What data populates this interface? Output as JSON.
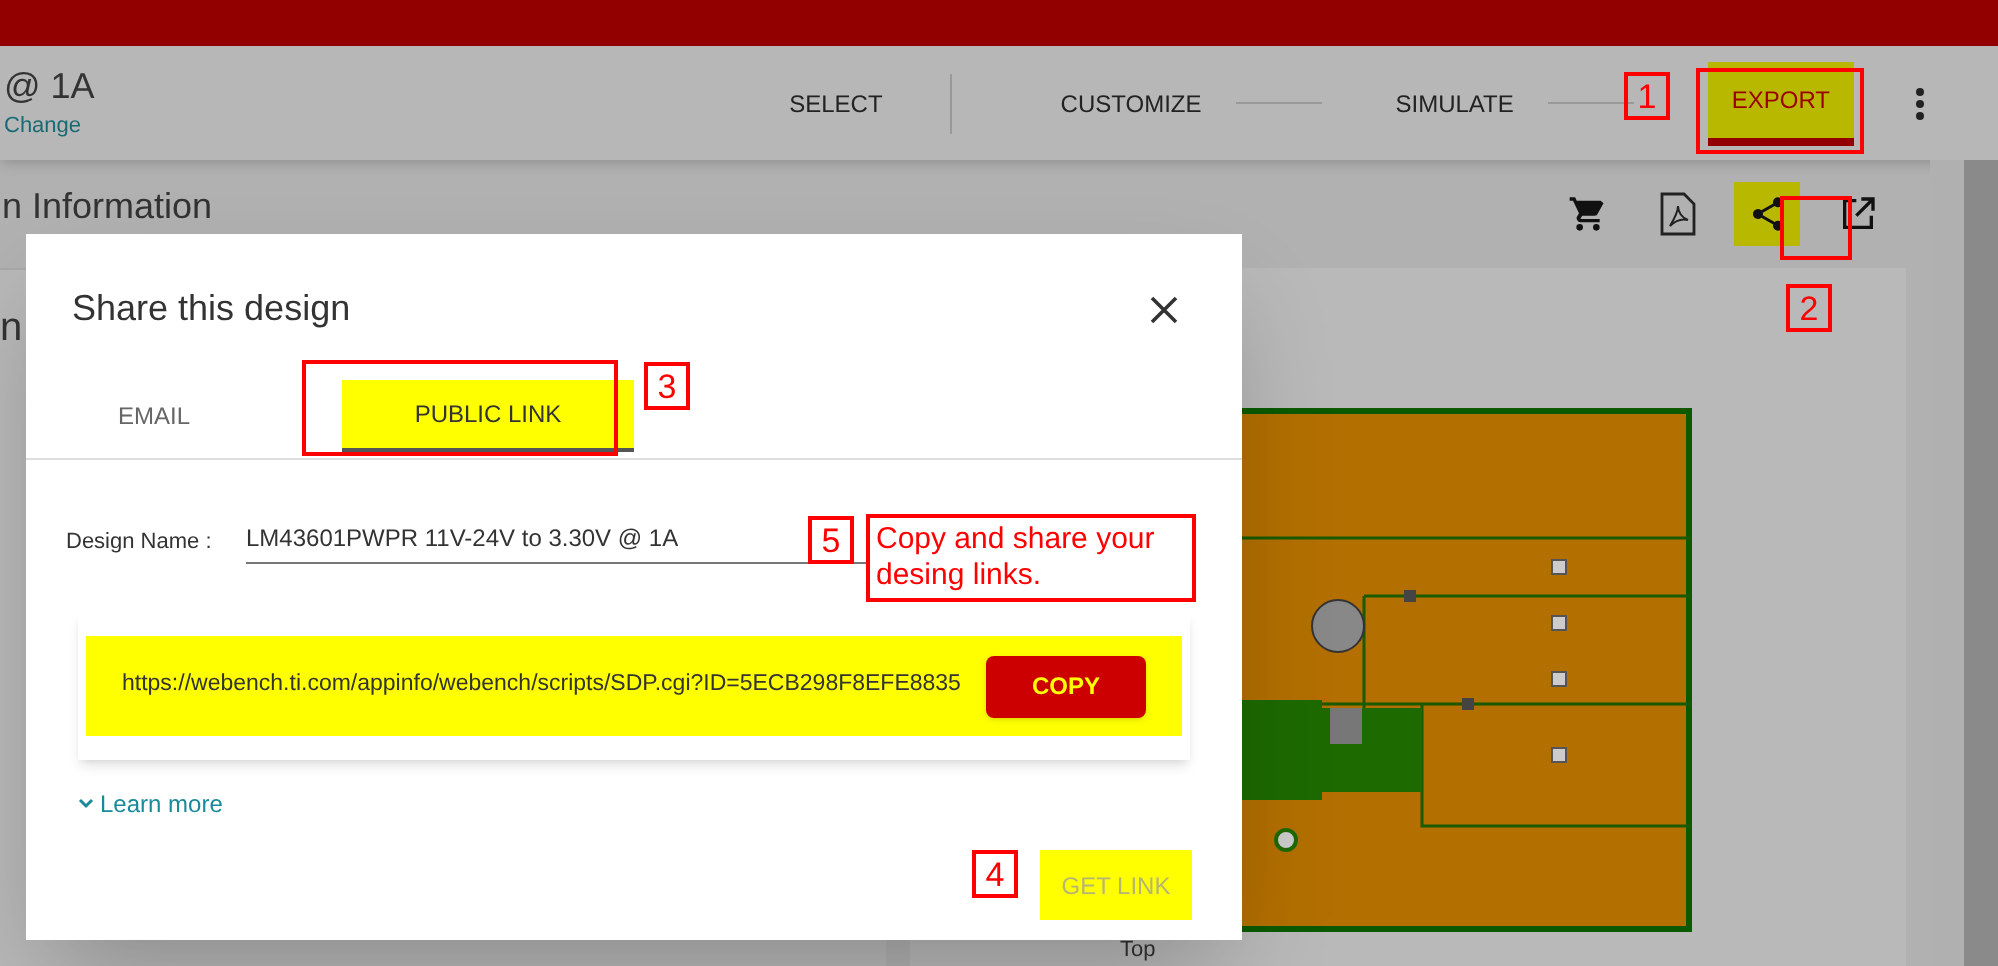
{
  "header": {
    "title": "@ 1A",
    "change_link": "Change"
  },
  "steps": [
    {
      "label": "SELECT",
      "selected": false
    },
    {
      "label": "CUSTOMIZE",
      "selected": false
    },
    {
      "label": "SIMULATE",
      "selected": false
    },
    {
      "label": "EXPORT",
      "selected": true
    }
  ],
  "section_title": "n Information",
  "toolbar_icons": [
    {
      "kind": "cart",
      "highlighted": false
    },
    {
      "kind": "pdf",
      "highlighted": false
    },
    {
      "kind": "share",
      "highlighted": true
    },
    {
      "kind": "external",
      "highlighted": false
    }
  ],
  "left_fragment": "n",
  "board_caption": "Top",
  "dialog": {
    "title": "Share this design",
    "tabs": [
      {
        "label": "EMAIL",
        "selected": false
      },
      {
        "label": "PUBLIC LINK",
        "selected": true
      }
    ],
    "design_name_label": "Design Name :",
    "design_name_value": "LM43601PWPR 11V-24V to 3.30V @ 1A",
    "link_url": "https://webench.ti.com/appinfo/webench/scripts/SDP.cgi?ID=5ECB298F8EFE8835",
    "copy_button": "COPY",
    "learn_more": "Learn more",
    "get_link_button": "GET LINK",
    "get_link_disabled": true
  },
  "annotations": [
    {
      "number": "1"
    },
    {
      "number": "2"
    },
    {
      "number": "3"
    },
    {
      "number": "4"
    },
    {
      "number": "5",
      "note": "Copy and share your desing links."
    }
  ]
}
